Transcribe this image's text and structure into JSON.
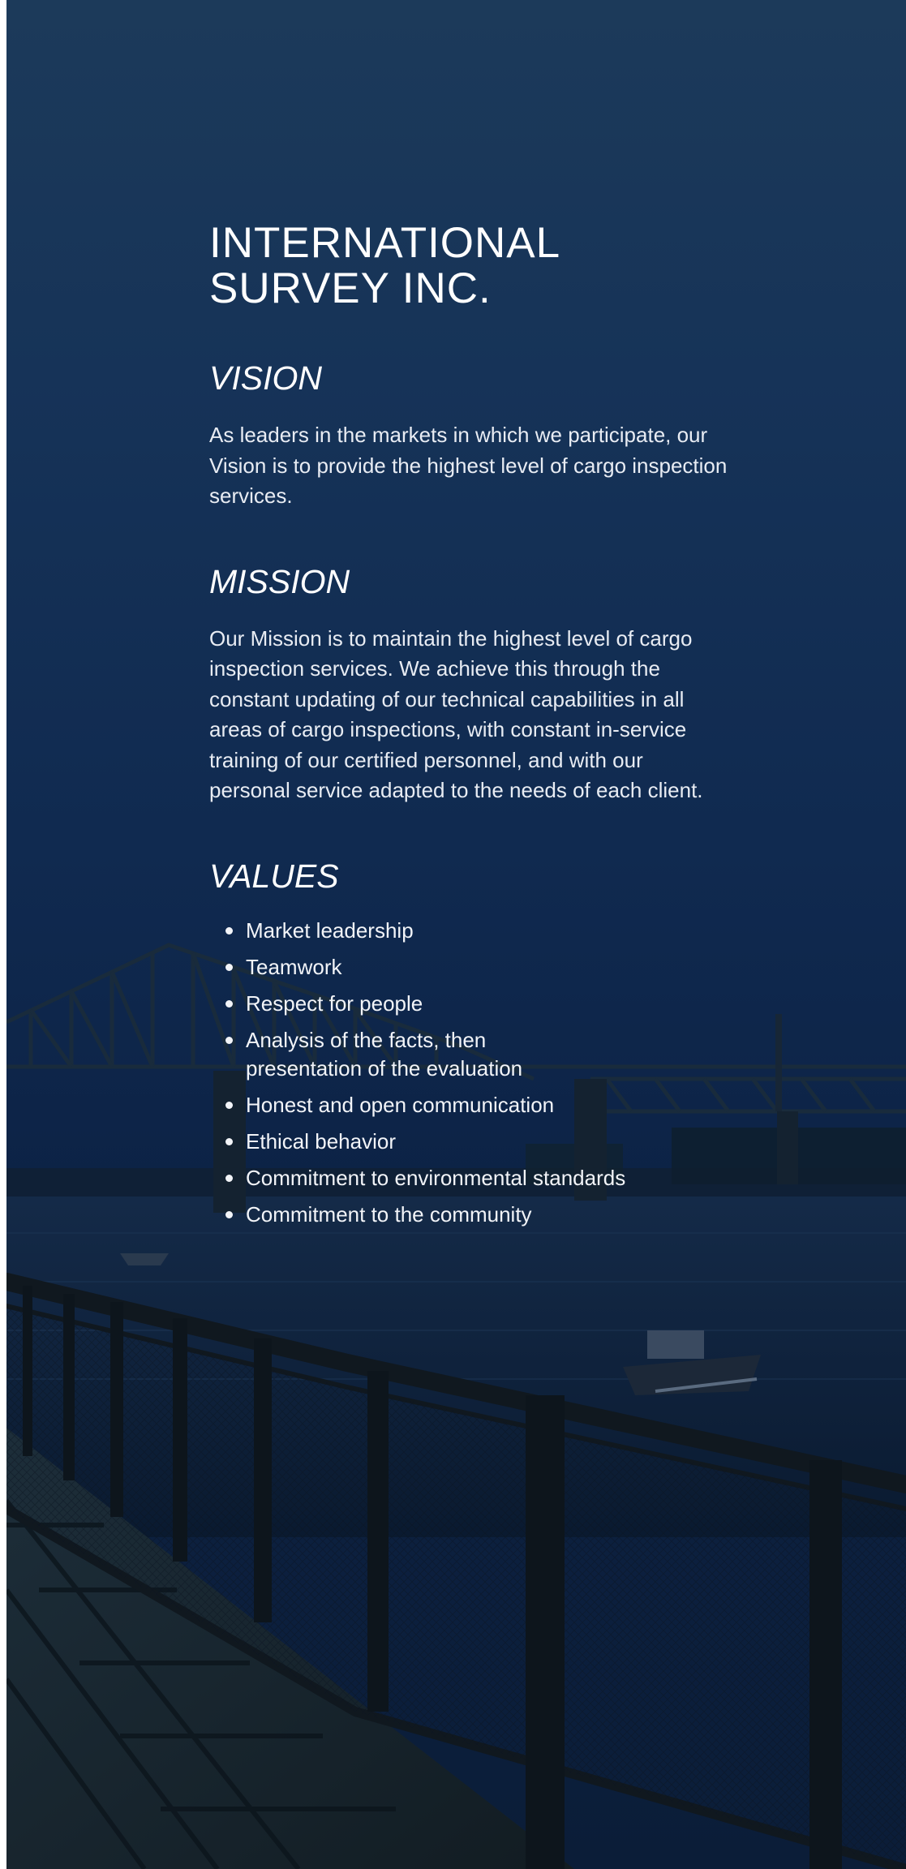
{
  "company": {
    "title": "INTERNATIONAL\nSURVEY INC."
  },
  "vision": {
    "heading": "VISION",
    "text": "As leaders in the markets in which we participate, our Vision is to provide the highest level of cargo inspection services."
  },
  "mission": {
    "heading": "MISSION",
    "text": "Our Mission is to maintain the highest level of cargo inspection services. We achieve this through the constant updating of our technical capabilities in all areas of cargo inspections, with constant in-service training of our certified personnel, and with our personal service adapted to the needs of each client."
  },
  "values": {
    "heading": "VALUES",
    "items": [
      "Market leadership",
      "Teamwork",
      "Respect for people",
      "Analysis of the facts, then presentation of the evaluation",
      "Honest and open communication",
      "Ethical behavior",
      "Commitment to environmental standards",
      "Commitment to the community"
    ]
  },
  "background": {
    "image": "harbor-bridge-photo",
    "overlay_color": "#0c2245"
  }
}
